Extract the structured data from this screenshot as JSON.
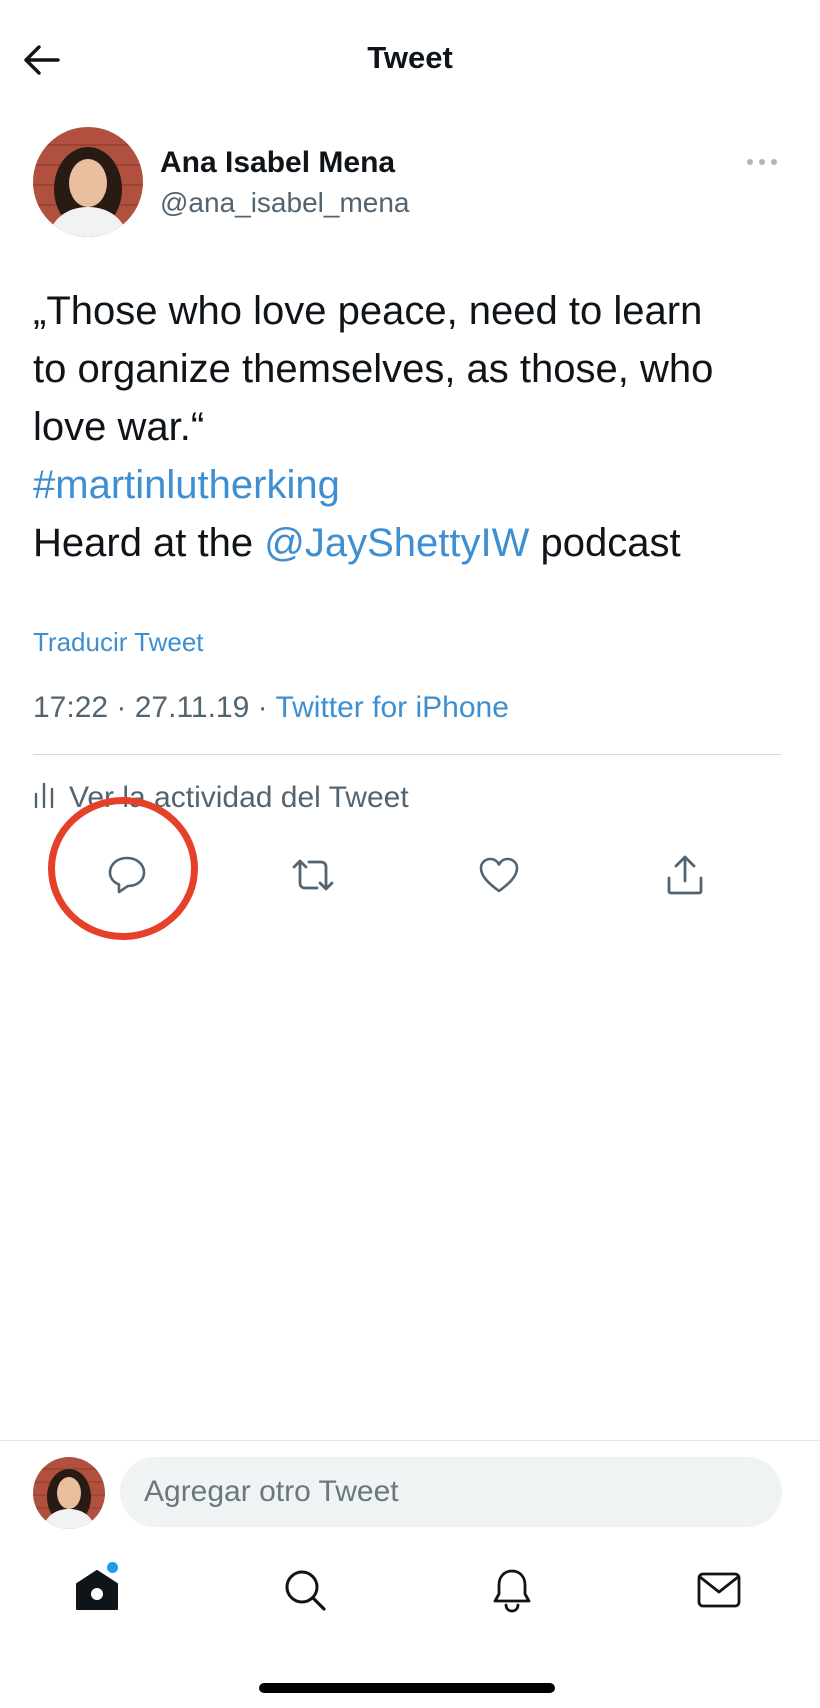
{
  "header": {
    "title": "Tweet"
  },
  "tweet": {
    "author_name": "Ana Isabel Mena",
    "author_handle": "@ana_isabel_mena",
    "text_line1": "„Those who love peace, need to learn",
    "text_line2": "to organize themselves, as those, who",
    "text_line3": "love war.“",
    "hashtag": "#martinlutherking",
    "text_line5_prefix": "Heard at the ",
    "mention": "@JayShettyIW",
    "text_line5_suffix": " podcast",
    "translate_label": "Traducir Tweet",
    "time": "17:22",
    "date": "27.11.19",
    "separator": " · ",
    "source": "Twitter for iPhone",
    "activity_label": "Ver la actividad del Tweet"
  },
  "composer": {
    "placeholder": "Agregar otro Tweet"
  },
  "icons": {
    "back": "arrow-left-icon",
    "more": "more-horizontal-icon",
    "activity": "bar-chart-icon",
    "reply": "reply-icon",
    "retweet": "retweet-icon",
    "like": "heart-icon",
    "share": "share-icon",
    "home": "home-icon",
    "search": "search-icon",
    "notifications": "bell-icon",
    "messages": "mail-icon"
  },
  "colors": {
    "link": "#3d8fd1",
    "secondary_text": "#536471",
    "highlight": "#e5402a",
    "notification_dot": "#1d9bf0"
  }
}
